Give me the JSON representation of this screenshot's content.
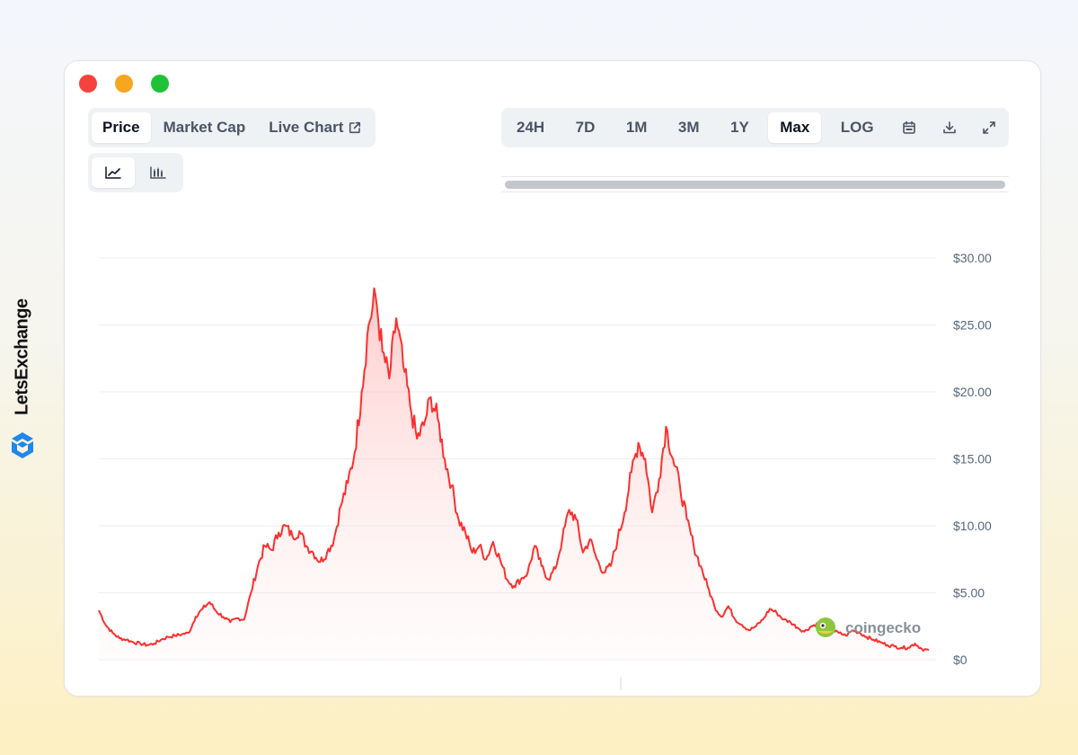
{
  "brand": {
    "name": "LetsExchange",
    "logo_icon": "letsexchange-logo-icon",
    "color": "#1e88f0"
  },
  "window": {
    "controls": [
      "close",
      "minimize",
      "maximize"
    ]
  },
  "view_tabs": [
    {
      "label": "Price",
      "active": true
    },
    {
      "label": "Market Cap",
      "active": false
    },
    {
      "label": "Live Chart",
      "active": false,
      "icon": "external-link-icon"
    }
  ],
  "chart_type_tabs": [
    {
      "icon": "line-chart-icon",
      "active": true
    },
    {
      "icon": "candlestick-icon",
      "active": false
    }
  ],
  "range_tabs": [
    {
      "label": "24H",
      "active": false
    },
    {
      "label": "7D",
      "active": false
    },
    {
      "label": "1M",
      "active": false
    },
    {
      "label": "3M",
      "active": false
    },
    {
      "label": "1Y",
      "active": false
    },
    {
      "label": "Max",
      "active": true
    },
    {
      "label": "LOG",
      "active": false
    }
  ],
  "range_actions": [
    {
      "icon": "calendar-icon"
    },
    {
      "icon": "download-icon"
    },
    {
      "icon": "expand-icon"
    }
  ],
  "watermark": {
    "text": "coingecko",
    "icon": "coingecko-logo-icon"
  },
  "chart_data": {
    "type": "area",
    "title": "",
    "xlabel": "",
    "ylabel": "",
    "ylim": [
      0,
      30
    ],
    "y_ticks": [
      0,
      5,
      10,
      15,
      20,
      25,
      30
    ],
    "y_tick_labels": [
      "$0",
      "$5.00",
      "$10.00",
      "$15.00",
      "$20.00",
      "$25.00",
      "$30.00"
    ],
    "y_axis_position": "right",
    "grid": true,
    "line_color": "#ff2e2e",
    "fill_color": "#ffd6d6",
    "series": [
      {
        "values": [
          3.7,
          2.6,
          2.0,
          1.6,
          1.5,
          1.3,
          1.2,
          1.1,
          1.2,
          1.5,
          1.7,
          1.8,
          1.9,
          2.0,
          3.2,
          3.8,
          4.3,
          3.6,
          3.2,
          2.8,
          3.1,
          3.0,
          5.0,
          7.0,
          8.5,
          8.2,
          9.5,
          10.0,
          9.2,
          9.6,
          8.5,
          8.0,
          7.3,
          8.0,
          9.0,
          11.5,
          13.2,
          15.5,
          20.0,
          25.0,
          27.2,
          23.0,
          21.0,
          25.5,
          22.0,
          19.0,
          16.5,
          17.5,
          19.6,
          18.0,
          15.0,
          13.0,
          10.5,
          9.5,
          8.0,
          8.5,
          7.5,
          8.8,
          7.5,
          6.0,
          5.5,
          6.0,
          6.5,
          8.5,
          7.0,
          6.0,
          6.8,
          9.0,
          11.2,
          10.5,
          8.0,
          9.0,
          7.5,
          6.5,
          7.0,
          9.0,
          11.0,
          14.0,
          16.2,
          15.0,
          11.0,
          13.5,
          17.4,
          15.0,
          13.0,
          10.5,
          8.5,
          7.0,
          5.5,
          4.0,
          3.2,
          4.0,
          3.0,
          2.6,
          2.2,
          2.5,
          3.0,
          3.8,
          3.5,
          3.0,
          2.8,
          2.4,
          2.1,
          2.5,
          2.7,
          2.4,
          2.2,
          2.0,
          1.8,
          2.2,
          2.0,
          1.7,
          1.5,
          1.3,
          1.1,
          1.0,
          0.9,
          0.9,
          1.2,
          0.8,
          0.7
        ]
      }
    ]
  }
}
